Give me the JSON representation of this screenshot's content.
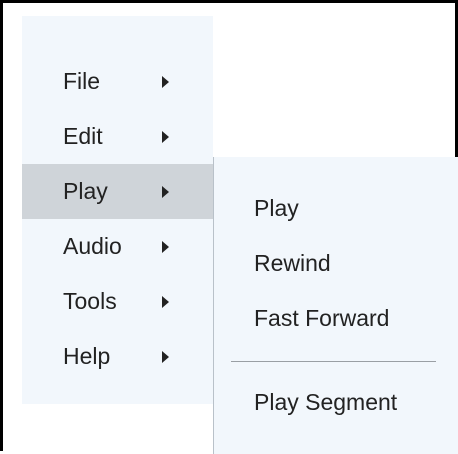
{
  "menu": {
    "items": [
      {
        "label": "File",
        "active": false
      },
      {
        "label": "Edit",
        "active": false
      },
      {
        "label": "Play",
        "active": true
      },
      {
        "label": "Audio",
        "active": false
      },
      {
        "label": "Tools",
        "active": false
      },
      {
        "label": "Help",
        "active": false
      }
    ]
  },
  "submenu": {
    "items": [
      {
        "label": "Play"
      },
      {
        "label": "Rewind"
      },
      {
        "label": "Fast Forward"
      },
      {
        "label": "Play Segment"
      }
    ]
  },
  "colors": {
    "menu_background": "#f2f7fc",
    "active_item_background": "#cfd4d9",
    "text": "#222222",
    "separator": "#9a9fa4",
    "frame_border": "#000000"
  },
  "icons": {
    "submenu_indicator": "triangle-right-icon"
  }
}
